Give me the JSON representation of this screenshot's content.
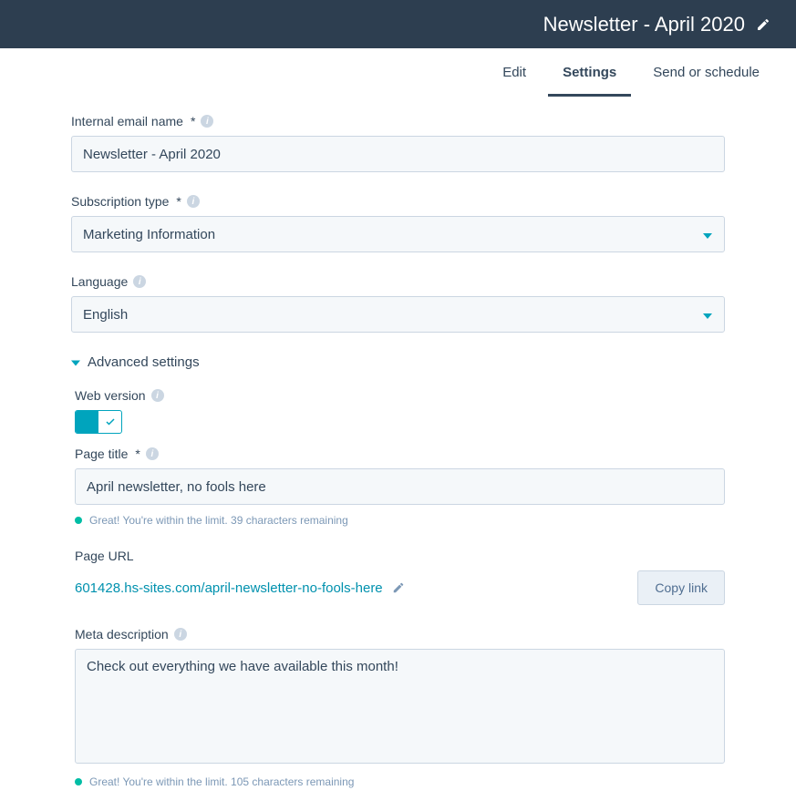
{
  "header": {
    "title": "Newsletter - April 2020"
  },
  "tabs": {
    "edit": "Edit",
    "settings": "Settings",
    "send": "Send or schedule"
  },
  "fields": {
    "internal_name": {
      "label": "Internal email name",
      "required": "*",
      "value": "Newsletter - April 2020"
    },
    "subscription_type": {
      "label": "Subscription type",
      "required": "*",
      "value": "Marketing Information"
    },
    "language": {
      "label": "Language",
      "value": "English"
    }
  },
  "advanced": {
    "header": "Advanced settings",
    "web_version": {
      "label": "Web version"
    },
    "page_title": {
      "label": "Page title",
      "required": "*",
      "value": "April newsletter, no fools here",
      "helper": "Great! You're within the limit. 39 characters remaining"
    },
    "page_url": {
      "label": "Page URL",
      "value": "601428.hs-sites.com/april-newsletter-no-fools-here",
      "copy_label": "Copy link"
    },
    "meta_description": {
      "label": "Meta description",
      "value": "Check out everything we have available this month!",
      "helper": "Great! You're within the limit. 105 characters remaining"
    }
  }
}
